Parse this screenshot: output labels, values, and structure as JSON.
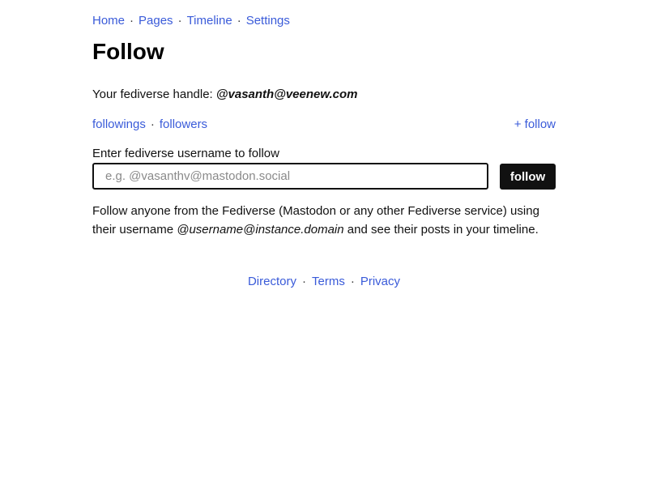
{
  "nav": {
    "items": [
      {
        "label": "Home"
      },
      {
        "label": "Pages"
      },
      {
        "label": "Timeline"
      },
      {
        "label": "Settings"
      }
    ],
    "separator": "·"
  },
  "page": {
    "title": "Follow"
  },
  "handle": {
    "prefix": "Your fediverse handle: ",
    "value": "@vasanth@veenew.com"
  },
  "links": {
    "followings": "followings",
    "followers": "followers",
    "add_follow": "+ follow"
  },
  "form": {
    "label": "Enter fediverse username to follow",
    "input_value": "",
    "input_placeholder": "e.g. @vasanthv@mastodon.social",
    "submit_label": "follow"
  },
  "help": {
    "before": "Follow anyone from the Fediverse (Mastodon or any other Fediverse service) using their username ",
    "format": "@username@instance.domain",
    "after": " and see their posts in your timeline."
  },
  "footer": {
    "items": [
      {
        "label": "Directory"
      },
      {
        "label": "Terms"
      },
      {
        "label": "Privacy"
      }
    ]
  },
  "colors": {
    "link": "#3a5bd9",
    "text": "#111111",
    "button_bg": "#111111",
    "button_text": "#ffffff",
    "placeholder": "#8a8a8a"
  }
}
